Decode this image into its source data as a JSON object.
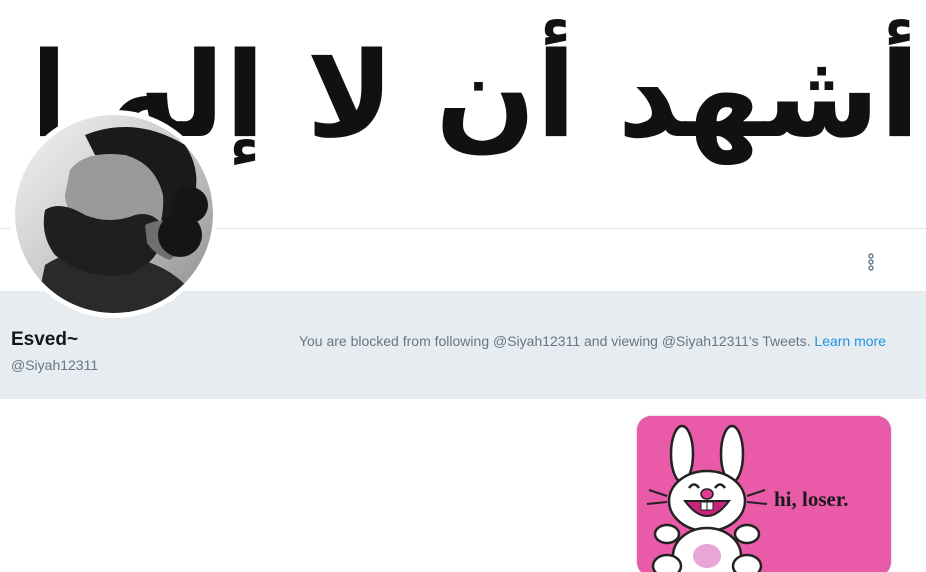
{
  "banner": {
    "arabic_text": "أشهد أن لا إله إلا الله"
  },
  "profile": {
    "name": "Esved~",
    "handle": "@Siyah12311"
  },
  "blocked": {
    "message": "You are blocked from following @Siyah12311 and viewing @Siyah12311's Tweets.",
    "learn_more": "Learn more"
  },
  "icons": {
    "more": "more-vertical-icon"
  },
  "media": {
    "sticker_text": "hi, loser."
  },
  "colors": {
    "strip_background": "#e6ecf0",
    "link": "#1b95e0",
    "muted_text": "#657786",
    "sticker_pink": "#e95aa8",
    "banner_red": "#d61a1a"
  }
}
